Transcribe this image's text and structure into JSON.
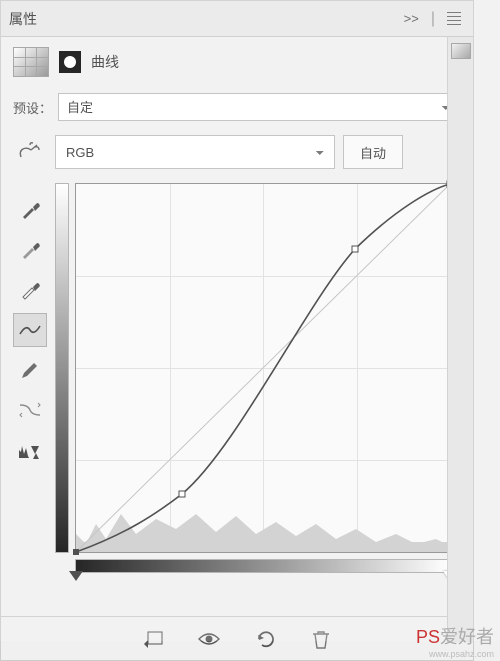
{
  "header": {
    "title": "属性",
    "collapse": ">>"
  },
  "adjustment": {
    "label": "曲线"
  },
  "preset": {
    "label": "预设：",
    "value": "自定"
  },
  "channel": {
    "value": "RGB",
    "auto": "自动"
  },
  "watermark": {
    "brand_prefix": "PS",
    "brand_suffix": "爱好者",
    "url": "www.psahz.com"
  },
  "chart_data": {
    "type": "line",
    "xlabel": "",
    "ylabel": "",
    "xlim": [
      0,
      255
    ],
    "ylim": [
      0,
      255
    ],
    "points": [
      {
        "x": 0,
        "y": 0
      },
      {
        "x": 72,
        "y": 40
      },
      {
        "x": 190,
        "y": 210
      },
      {
        "x": 255,
        "y": 255
      }
    ],
    "baseline": [
      {
        "x": 0,
        "y": 0
      },
      {
        "x": 255,
        "y": 255
      }
    ],
    "sliders": {
      "black": 0,
      "white": 255
    }
  }
}
